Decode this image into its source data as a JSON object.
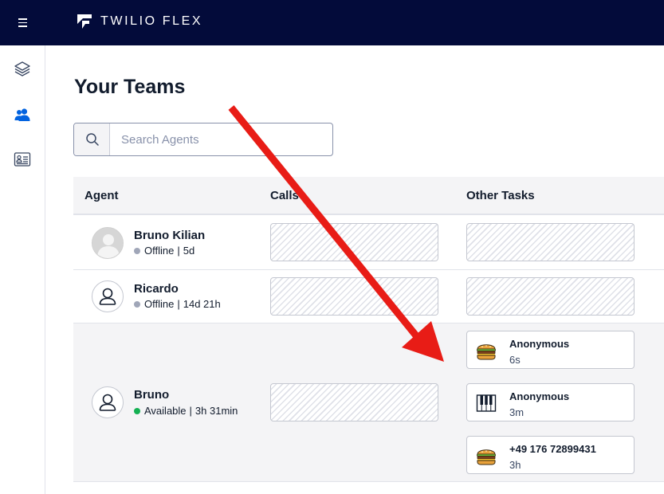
{
  "topbar": {
    "brand": "TWILIO FLEX"
  },
  "sidenav": {
    "items": [
      "layers-icon",
      "teams-icon",
      "contact-card-icon"
    ]
  },
  "page": {
    "title": "Your Teams"
  },
  "search": {
    "placeholder": "Search Agents",
    "value": ""
  },
  "table": {
    "columns": [
      "Agent",
      "Calls",
      "Other Tasks"
    ],
    "rows": [
      {
        "name": "Bruno Kilian",
        "status": "Offline",
        "duration": "5d",
        "status_color": "#a0a6b8",
        "avatar": "photo-avatar"
      },
      {
        "name": "Ricardo",
        "status": "Offline",
        "duration": "14d 21h",
        "status_color": "#a0a6b8",
        "avatar": "default-avatar"
      },
      {
        "name": "Bruno",
        "status": "Available",
        "duration": "3h 31min",
        "status_color": "#14b053",
        "avatar": "default-avatar",
        "tasks": [
          {
            "title": "Anonymous",
            "time": "6s",
            "icon": "burger-icon"
          },
          {
            "title": "Anonymous",
            "time": "3m",
            "icon": "piano-icon"
          },
          {
            "title": "+49 176 72899431",
            "time": "3h",
            "icon": "burger-icon"
          }
        ]
      }
    ]
  },
  "separator": "|",
  "colors": {
    "topbar": "#030b3a",
    "accent": "#0263e0",
    "arrow": "#e81c16",
    "available": "#14b053",
    "offline": "#a0a6b8"
  }
}
